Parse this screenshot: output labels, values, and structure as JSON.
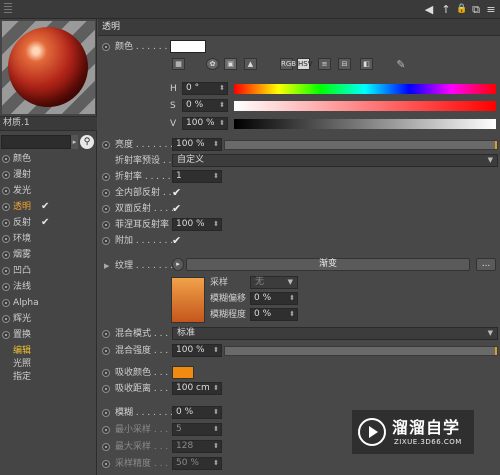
{
  "toolbar": {
    "back_arrow": "◀",
    "up_arrow": "↑",
    "lock": "🔒",
    "new_window": "⧉",
    "more": "≡"
  },
  "sidebar": {
    "material_name": "材质.1",
    "channels": [
      {
        "label": "颜色",
        "checked": false,
        "active": false
      },
      {
        "label": "漫射",
        "checked": false,
        "active": false
      },
      {
        "label": "发光",
        "checked": false,
        "active": false
      },
      {
        "label": "透明",
        "checked": true,
        "active": true
      },
      {
        "label": "反射",
        "checked": true,
        "active": false
      },
      {
        "label": "环境",
        "checked": false,
        "active": false
      },
      {
        "label": "烟雾",
        "checked": false,
        "active": false
      },
      {
        "label": "凹凸",
        "checked": false,
        "active": false
      },
      {
        "label": "法线",
        "checked": false,
        "active": false
      },
      {
        "label": "Alpha",
        "checked": false,
        "active": false
      },
      {
        "label": "辉光",
        "checked": false,
        "active": false
      },
      {
        "label": "置换",
        "checked": false,
        "active": false
      }
    ],
    "sub_items": [
      {
        "label": "编辑",
        "active": true
      },
      {
        "label": "光照",
        "active": false
      },
      {
        "label": "指定",
        "active": false
      }
    ],
    "check_glyph": "✔"
  },
  "panel": {
    "title": "透明",
    "color_label": "颜色 . . . . . . .",
    "color_swatch": "#ffffff",
    "color_mode_active": "HSV",
    "color_modes": [
      "RGB",
      "HSV"
    ],
    "hsv": [
      {
        "label": "H",
        "value": "0 °"
      },
      {
        "label": "S",
        "value": "0 %"
      },
      {
        "label": "V",
        "value": "100 %"
      }
    ],
    "brightness": {
      "label": "亮度 . . . . . . .",
      "value": "100 %",
      "fraction": 1.0
    },
    "preset": {
      "label": "折射率预设 . . .",
      "value": "自定义"
    },
    "refraction": {
      "label": "折射率 . . . . .",
      "value": "1"
    },
    "total_internal": {
      "label": "全内部反射 . . .",
      "checked": true
    },
    "double_sided": {
      "label": "双面反射 . . . .",
      "checked": true
    },
    "fresnel": {
      "label": "菲涅耳反射率",
      "value": "100 %",
      "fraction": 1.0
    },
    "additive": {
      "label": "附加 . . . . . . .",
      "checked": true
    },
    "texture": {
      "label": "纹理 . . . . . . . .",
      "shader_name": "渐变",
      "more": "...",
      "sampling_label": "采样",
      "sampling_value": "无",
      "blur_offset_label": "模糊偏移",
      "blur_offset_value": "0 %",
      "blur_scale_label": "模糊程度",
      "blur_scale_value": "0 %",
      "gradient_top": "#f1a24a",
      "gradient_bottom": "#c5561b"
    },
    "mix_mode": {
      "label": "混合模式 . . . . .",
      "value": "标准"
    },
    "mix_strength": {
      "label": "混合强度 . . . . .",
      "value": "100 %",
      "fraction": 1.0
    },
    "absorption_color": {
      "label": "吸收颜色 . . . .",
      "color": "#f08a10"
    },
    "absorption_distance": {
      "label": "吸收距离 . . . .",
      "value": "100 cm"
    },
    "blur": {
      "label": "模糊 . . . . . . .",
      "value": "0 %"
    },
    "min_samples": {
      "label": "最小采样 . . .",
      "value": "5"
    },
    "max_samples": {
      "label": "最大采样 . . .",
      "value": "128"
    },
    "sample_precision": {
      "label": "采样精度 . . .",
      "value": "50 %"
    }
  },
  "watermark": {
    "title": "溜溜自学",
    "subtitle": "ZIXUE.3D66.COM"
  },
  "colors": {
    "accent_orange": "#e09a2a",
    "active_channel": "#f0a030"
  }
}
